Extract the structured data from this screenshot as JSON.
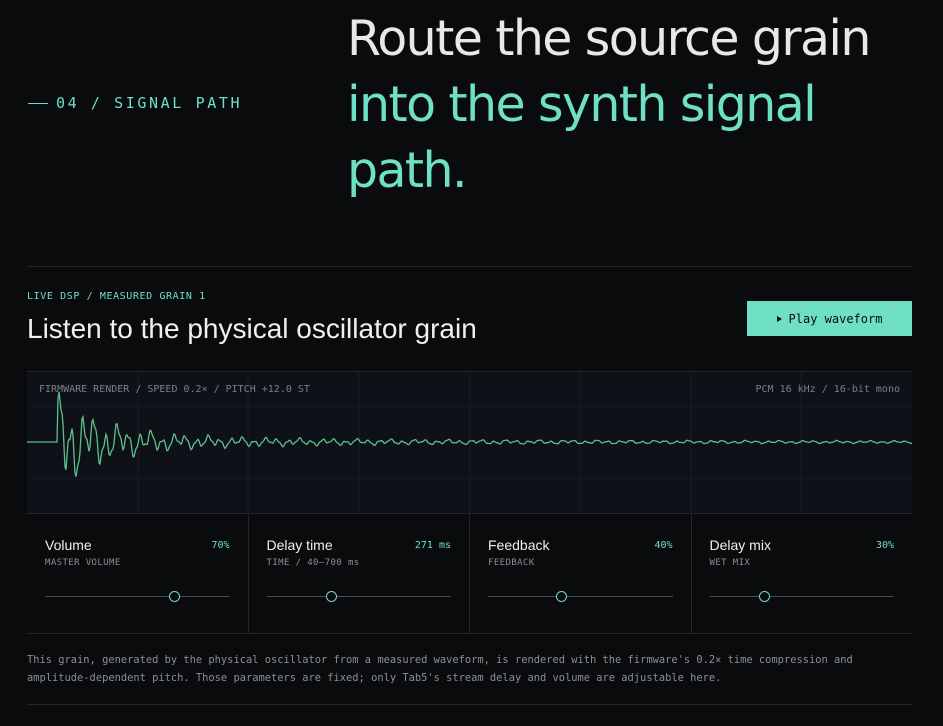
{
  "section": {
    "eyebrow": "04 / SIGNAL PATH",
    "headline_line1": "Route the source grain",
    "headline_line2": "into the synth signal path."
  },
  "player": {
    "kicker": "LIVE DSP / MEASURED GRAIN 1",
    "title": "Listen to the physical oscillator grain",
    "play_label": "Play waveform"
  },
  "waveform": {
    "left_label": "FIRMWARE RENDER / SPEED 0.2× / PITCH +12.0 ST",
    "right_label": "PCM 16 kHz / 16-bit mono",
    "stroke_color": "#5fbf8a"
  },
  "controls": [
    {
      "label": "Volume",
      "sub": "MASTER VOLUME",
      "value": "70%",
      "level": 0.7
    },
    {
      "label": "Delay time",
      "sub": "TIME / 40–700 ms",
      "value": "271 ms",
      "level": 0.35
    },
    {
      "label": "Feedback",
      "sub": "FEEDBACK",
      "value": "40%",
      "level": 0.4
    },
    {
      "label": "Delay mix",
      "sub": "WET MIX",
      "value": "30%",
      "level": 0.3
    }
  ],
  "footnote": "This grain, generated by the physical oscillator from a measured waveform, is rendered with the firmware's 0.2× time compression and amplitude-dependent pitch. Those parameters are fixed; only Tab5's stream delay and volume are adjustable here.",
  "colors": {
    "accent": "#6fe0c6",
    "background": "#0a0b0d",
    "panel": "#0e1117"
  }
}
